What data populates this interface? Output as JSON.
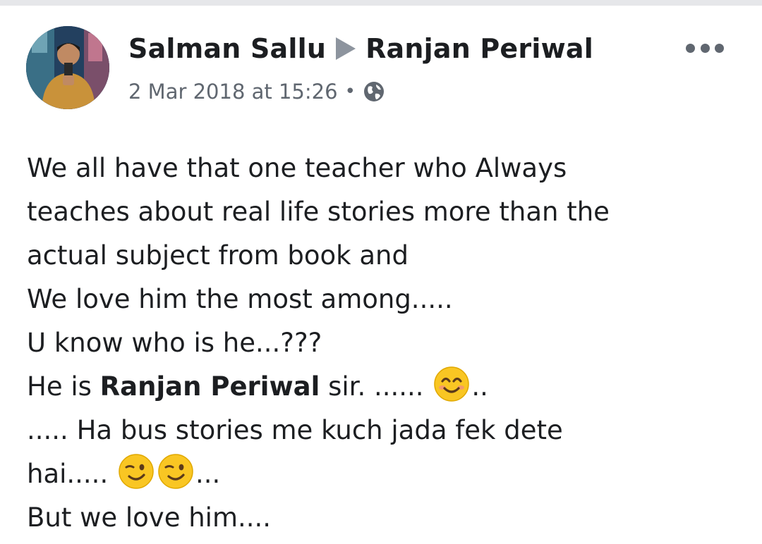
{
  "post": {
    "author": "Salman Sallu",
    "target": "Ranjan Periwal",
    "timestamp": "2 Mar 2018 at 15:26",
    "separator": "•",
    "privacy_icon": "globe-icon",
    "more_icon": "more-options-icon",
    "lines": {
      "l1": "We all have that one teacher who Always",
      "l2": "teaches about real life stories more than the",
      "l3": "actual subject from book and",
      "l4": "We love him the most among.....",
      "l5": "U know who is he...???",
      "l6_a": "He is ",
      "l6_mention": "Ranjan Periwal",
      "l6_b": " sir. ...... ",
      "l6_c": "..",
      "l7": "..... Ha bus stories me kuch jada fek dete",
      "l8_a": "hai..... ",
      "l8_b": "...",
      "l9": "But we love him...."
    },
    "emojis": [
      "smiling-face-emoji",
      "winking-face-emoji",
      "winking-face-emoji"
    ]
  },
  "colors": {
    "text": "#1c1e21",
    "meta": "#606770",
    "arrow": "#8d949e",
    "emoji_face": "#f9c623"
  }
}
